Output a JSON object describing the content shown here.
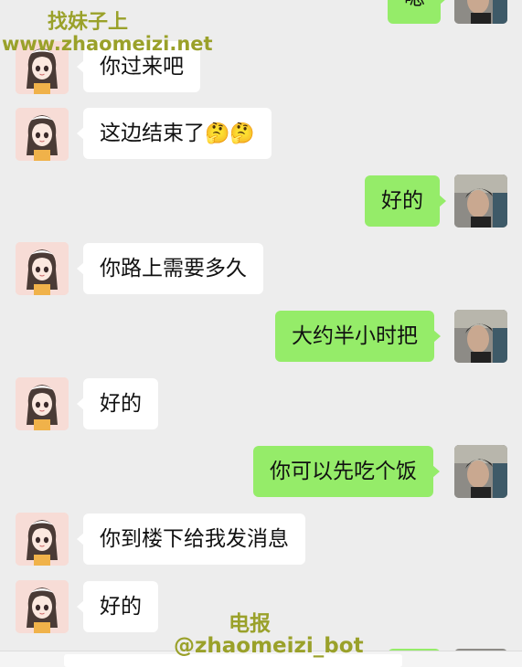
{
  "watermark": {
    "site_name": "找妹子上",
    "site_url": "www.zhaomeizi.net",
    "telegram_label": "电报",
    "telegram_handle": "@zhaomeizi_bot"
  },
  "messages": [
    {
      "side": "right",
      "text": "嗯"
    },
    {
      "side": "left",
      "text": "你过来吧"
    },
    {
      "side": "left",
      "text": "这边结束了",
      "emoji": "🤔🤔"
    },
    {
      "side": "right",
      "text": "好的"
    },
    {
      "side": "left",
      "text": "你路上需要多久"
    },
    {
      "side": "right",
      "text": "大约半小时把"
    },
    {
      "side": "left",
      "text": "好的"
    },
    {
      "side": "right",
      "text": "你可以先吃个饭"
    },
    {
      "side": "left",
      "text": "你到楼下给我发消息"
    },
    {
      "side": "left",
      "text": "好的"
    }
  ],
  "colors": {
    "background": "#ededed",
    "bubble_sent": "#95ec69",
    "bubble_received": "#ffffff",
    "watermark": "#9aa12a"
  }
}
